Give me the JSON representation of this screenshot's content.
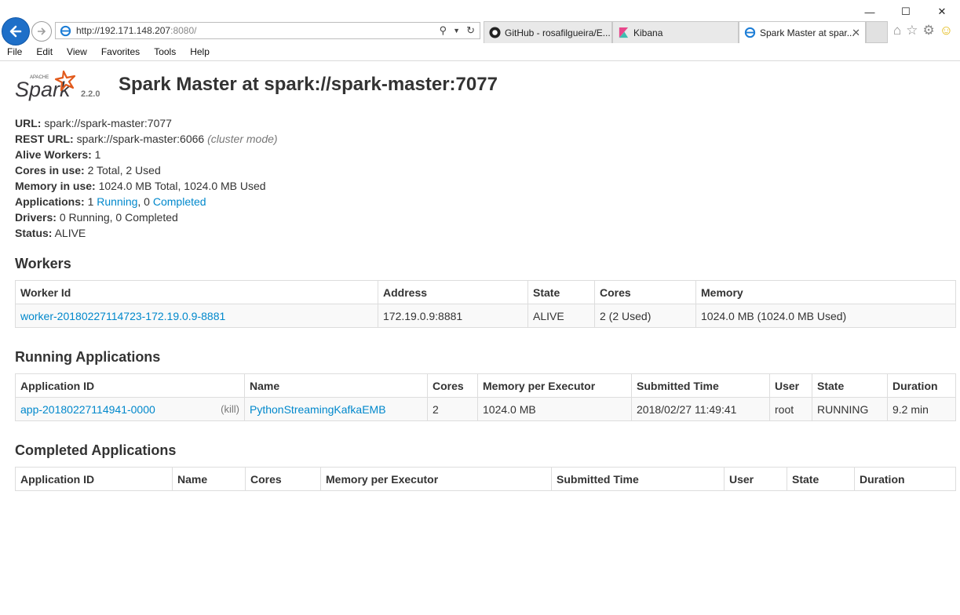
{
  "browser": {
    "url_host": "http://192.171.148.207",
    "url_port": ":8080/",
    "tabs": [
      {
        "label": "GitHub - rosafilgueira/E..."
      },
      {
        "label": "Kibana"
      },
      {
        "label": "Spark Master at spar..."
      }
    ],
    "menu": [
      "File",
      "Edit",
      "View",
      "Favorites",
      "Tools",
      "Help"
    ]
  },
  "header": {
    "version": "2.2.0",
    "title": "Spark Master at spark://spark-master:7077"
  },
  "summary": {
    "url_label": "URL:",
    "url_value": "spark://spark-master:7077",
    "rest_label": "REST URL:",
    "rest_value": "spark://spark-master:6066",
    "rest_mode": "(cluster mode)",
    "alive_label": "Alive Workers:",
    "alive_value": "1",
    "cores_label": "Cores in use:",
    "cores_value": "2 Total, 2 Used",
    "memory_label": "Memory in use:",
    "memory_value": "1024.0 MB Total, 1024.0 MB Used",
    "apps_label": "Applications:",
    "apps_running_count": "1",
    "apps_running_link": "Running",
    "apps_sep": ", 0",
    "apps_completed_link": "Completed",
    "drivers_label": "Drivers:",
    "drivers_value": "0 Running, 0 Completed",
    "status_label": "Status:",
    "status_value": "ALIVE"
  },
  "workers": {
    "heading": "Workers",
    "columns": [
      "Worker Id",
      "Address",
      "State",
      "Cores",
      "Memory"
    ],
    "rows": [
      [
        "worker-20180227114723-172.19.0.9-8881",
        "172.19.0.9:8881",
        "ALIVE",
        "2 (2 Used)",
        "1024.0 MB (1024.0 MB Used)"
      ]
    ]
  },
  "running": {
    "heading": "Running Applications",
    "columns": [
      "Application ID",
      "Name",
      "Cores",
      "Memory per Executor",
      "Submitted Time",
      "User",
      "State",
      "Duration"
    ],
    "kill_label": "(kill)",
    "rows": [
      [
        "app-20180227114941-0000",
        "PythonStreamingKafkaEMB",
        "2",
        "1024.0 MB",
        "2018/02/27 11:49:41",
        "root",
        "RUNNING",
        "9.2 min"
      ]
    ]
  },
  "completed": {
    "heading": "Completed Applications",
    "columns": [
      "Application ID",
      "Name",
      "Cores",
      "Memory per Executor",
      "Submitted Time",
      "User",
      "State",
      "Duration"
    ]
  }
}
